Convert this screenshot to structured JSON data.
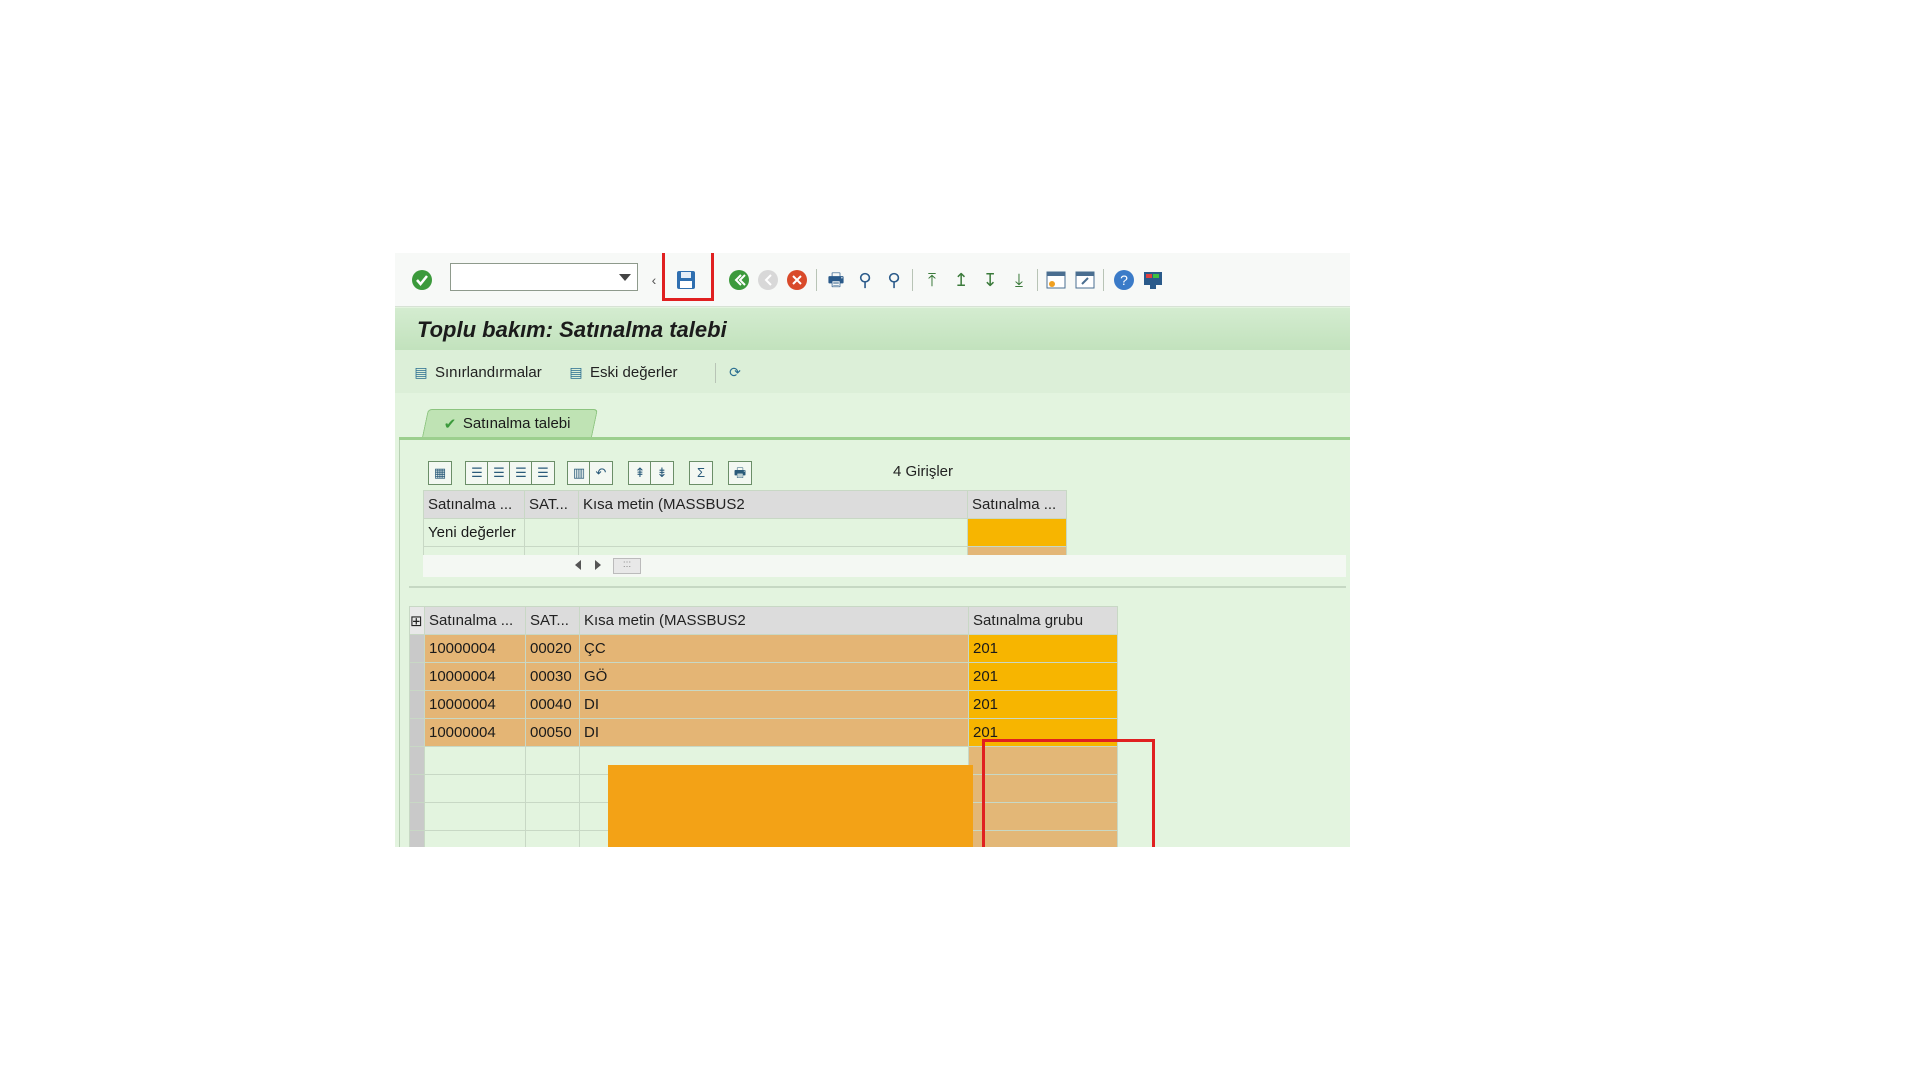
{
  "toolbar": {
    "command_field_value": "",
    "icons": [
      "enter-checkmark-icon",
      "save-icon",
      "back-icon",
      "exit-icon",
      "cancel-icon",
      "print-icon",
      "find-icon",
      "find-next-icon",
      "first-page-icon",
      "previous-page-icon",
      "next-page-icon",
      "last-page-icon",
      "new-session-icon",
      "create-shortcut-icon",
      "help-icon",
      "customize-layout-icon"
    ]
  },
  "title": "Toplu bakım: Satınalma talebi",
  "app_toolbar": {
    "restrictions_label": "Sınırlandırmalar",
    "old_values_label": "Eski değerler"
  },
  "tab": {
    "label": "Satınalma talebi"
  },
  "entries": {
    "count": "4",
    "label": "Girişler"
  },
  "new_values_grid": {
    "headers": [
      "Satınalma ...",
      "SAT...",
      "Kısa metin (MASSBUS2",
      "Satınalma ..."
    ],
    "row_label": "Yeni değerler"
  },
  "items_grid": {
    "headers": [
      "Satınalma ...",
      "SAT...",
      "Kısa metin (MASSBUS2",
      "Satınalma grubu"
    ],
    "rows": [
      {
        "pr": "10000004",
        "item": "00020",
        "text": "ÇC",
        "group": "201"
      },
      {
        "pr": "10000004",
        "item": "00030",
        "text": "GÖ",
        "group": "201"
      },
      {
        "pr": "10000004",
        "item": "00040",
        "text": "DI",
        "group": "201"
      },
      {
        "pr": "10000004",
        "item": "00050",
        "text": "DI",
        "group": "201"
      }
    ]
  },
  "colors": {
    "highlight_box": "#e02020",
    "group_cell": "#f7b500",
    "sap_background": "#e3f4df"
  }
}
